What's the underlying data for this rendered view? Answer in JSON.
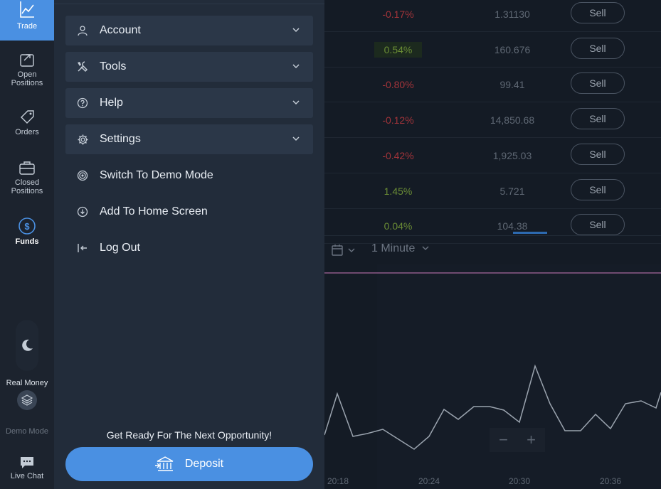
{
  "rail": {
    "items": [
      {
        "label": "Trade",
        "icon": "chart-line-icon"
      },
      {
        "label": "Open Positions",
        "icon": "open-positions-icon"
      },
      {
        "label": "Orders",
        "icon": "tag-icon"
      },
      {
        "label": "Closed Positions",
        "icon": "briefcase-icon"
      },
      {
        "label": "Funds",
        "icon": "dollar-circle-icon"
      }
    ],
    "real_money": "Real Money",
    "demo_mode": "Demo Mode",
    "live_chat": "Live Chat"
  },
  "drawer": {
    "accordions": [
      {
        "label": "Account",
        "icon": "user-icon"
      },
      {
        "label": "Tools",
        "icon": "tools-icon"
      },
      {
        "label": "Help",
        "icon": "help-circle-icon"
      },
      {
        "label": "Settings",
        "icon": "gear-icon"
      }
    ],
    "items": [
      {
        "label": "Switch To Demo Mode",
        "icon": "target-icon"
      },
      {
        "label": "Add To Home Screen",
        "icon": "download-circle-icon"
      },
      {
        "label": "Log Out",
        "icon": "logout-icon"
      }
    ],
    "promo": "Get Ready For The Next Opportunity!",
    "deposit_label": "Deposit"
  },
  "market_rows": [
    {
      "change": "-0.17%",
      "price": "1.31130",
      "action": "Sell"
    },
    {
      "change": "0.54%",
      "price": "160.676",
      "action": "Sell"
    },
    {
      "change": "-0.80%",
      "price": "99.41",
      "action": "Sell"
    },
    {
      "change": "-0.12%",
      "price": "14,850.68",
      "action": "Sell"
    },
    {
      "change": "-0.42%",
      "price": "1,925.03",
      "action": "Sell"
    },
    {
      "change": "1.45%",
      "price": "5.721",
      "action": "Sell"
    },
    {
      "change": "0.04%",
      "price": "104.38",
      "action": "Sell"
    }
  ],
  "chart": {
    "timeframe": "1 Minute",
    "x_ticks": [
      "20:18",
      "20:24",
      "20:30",
      "20:36"
    ],
    "zoom_out": "−",
    "zoom_in": "+"
  },
  "colors": {
    "accent": "#4a90e2",
    "negative": "#a3343a",
    "positive": "#6a8c35",
    "line": "#9aa3ae",
    "marker_line": "#8e5b8a"
  }
}
